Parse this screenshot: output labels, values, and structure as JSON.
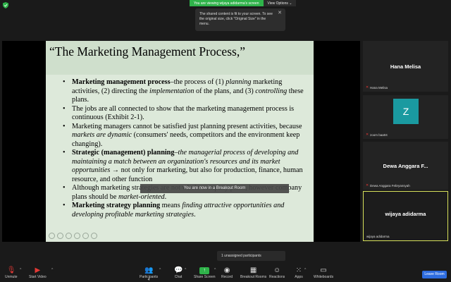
{
  "top_banner": {
    "sharing_text": "You are viewing wijaya adidarma's screen",
    "view_options_label": "View Options"
  },
  "tooltip": {
    "message": "The shared content is fit to your screen. To see the original size, click \"Original Size\" in the menu."
  },
  "slide": {
    "title": "“The Marketing Management Process,”",
    "bullets": [
      "Marketing management process–the process of (1) planning marketing activities, (2) directing the implementation of the plans, and (3) controlling these plans.",
      "The jobs are all connected to show that the marketing management process is continuous (Exhibit 2-1).",
      "Marketing managers cannot be satisfied just planning present activities, because markets are dynamic (consumers' needs, competitors and the environment keep changing).",
      "Strategic (management) planning–the managerial process of developing and maintaining a match between an organization's resources and its market opportunities → not only for marketing, but also for production, finance, human resource, and other function",
      "Although marketing strategies are not whole-company plans, however company plans should be market-oriented.",
      "Marketing strategy planning means finding attractive opportunities and developing profitable marketing strategies."
    ]
  },
  "breakout_notice": "You are now in a Breakout Room",
  "participants": [
    {
      "display_name": "Hana Melisa",
      "label": "Hana Melisa"
    },
    {
      "avatar_letter": "Z",
      "label": "zoom baa04"
    },
    {
      "display_name": "Dewa Anggara F...",
      "label": "Dewa Anggara Febryansyah"
    },
    {
      "display_name": "wijaya adidarma",
      "label": "wijaya adidarma"
    }
  ],
  "unassigned_text": "1 unassigned participants",
  "toolbar": {
    "unmute": "Unmute",
    "start_video": "Start Video",
    "participants": "Participants",
    "participants_count": "4",
    "chat": "Chat",
    "share_screen": "Share Screen",
    "record": "Record",
    "breakout_rooms": "Breakout Rooms",
    "reactions": "Reactions",
    "apps": "Apps",
    "whiteboards": "Whiteboards",
    "leave": "Leave Room"
  },
  "colors": {
    "share_green": "#2fb34a",
    "leave_blue": "#2d6cdf",
    "active_speaker_border": "#d6e05a",
    "avatar_teal": "#1a9aa0",
    "slide_bg": "#dde9da"
  }
}
